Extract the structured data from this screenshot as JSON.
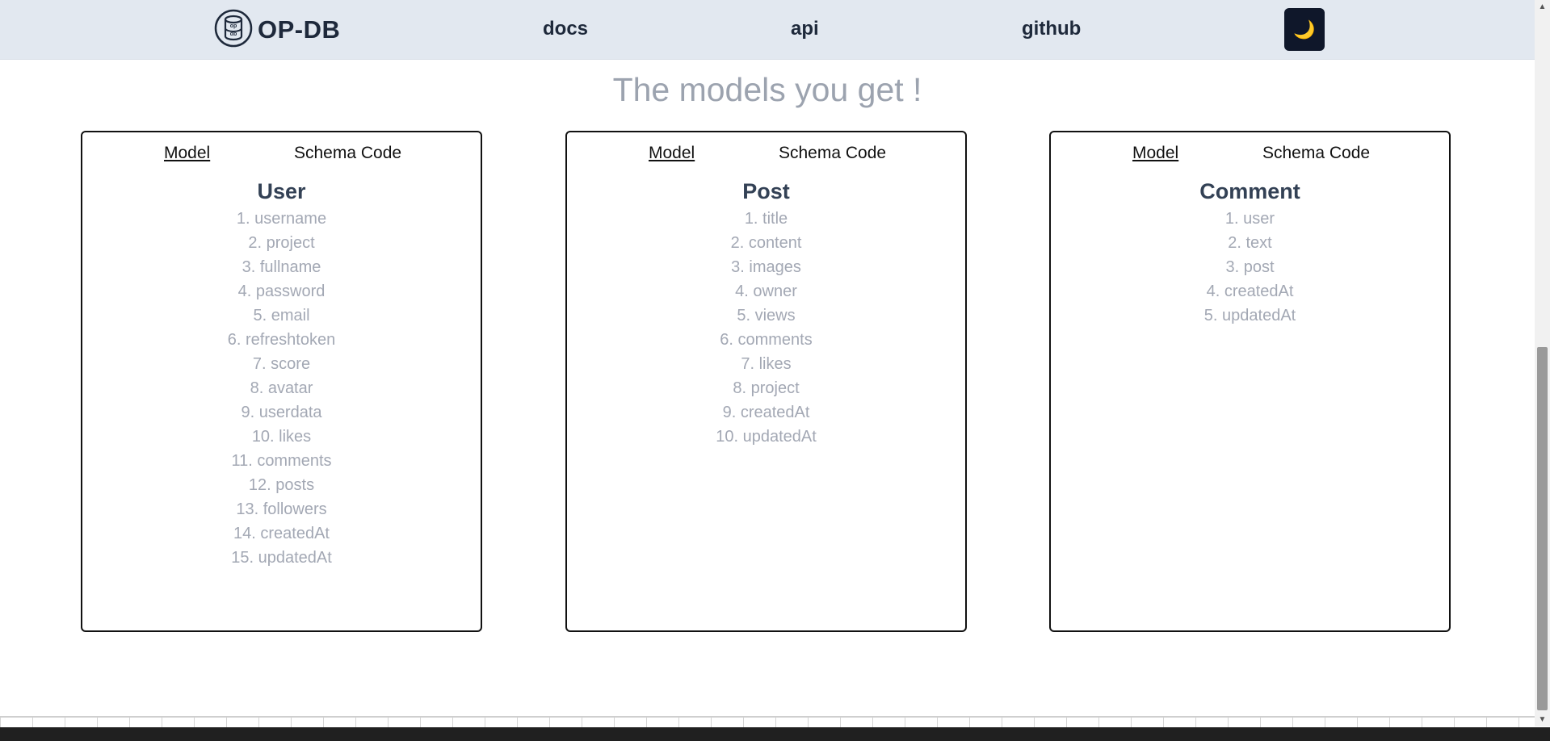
{
  "navbar": {
    "brand_name": "OP-DB",
    "logo_text": "op db",
    "links": [
      "docs",
      "api",
      "github"
    ],
    "theme_toggle_icon": "moon-icon",
    "theme_toggle_glyph": "🌙"
  },
  "heading": "The models you get !",
  "models": [
    {
      "tab_model": "Model",
      "tab_schema": "Schema Code",
      "name": "User",
      "fields": [
        "1. username",
        "2. project",
        "3. fullname",
        "4. password",
        "5. email",
        "6. refreshtoken",
        "7. score",
        "8. avatar",
        "9. userdata",
        "10. likes",
        "11. comments",
        "12. posts",
        "13. followers",
        "14. createdAt",
        "15. updatedAt"
      ]
    },
    {
      "tab_model": "Model",
      "tab_schema": "Schema Code",
      "name": "Post",
      "fields": [
        "1. title",
        "2. content",
        "3. images",
        "4. owner",
        "5. views",
        "6. comments",
        "7. likes",
        "8. project",
        "9. createdAt",
        "10. updatedAt"
      ]
    },
    {
      "tab_model": "Model",
      "tab_schema": "Schema Code",
      "name": "Comment",
      "fields": [
        "1. user",
        "2. text",
        "3. post",
        "4. createdAt",
        "5. updatedAt"
      ]
    }
  ],
  "colors": {
    "navbar_bg": "#e2e8f0",
    "theme_button_bg": "#0f172a",
    "heading": "#9ca3af",
    "field_text": "#a3a8b4",
    "title_text": "#334155"
  }
}
